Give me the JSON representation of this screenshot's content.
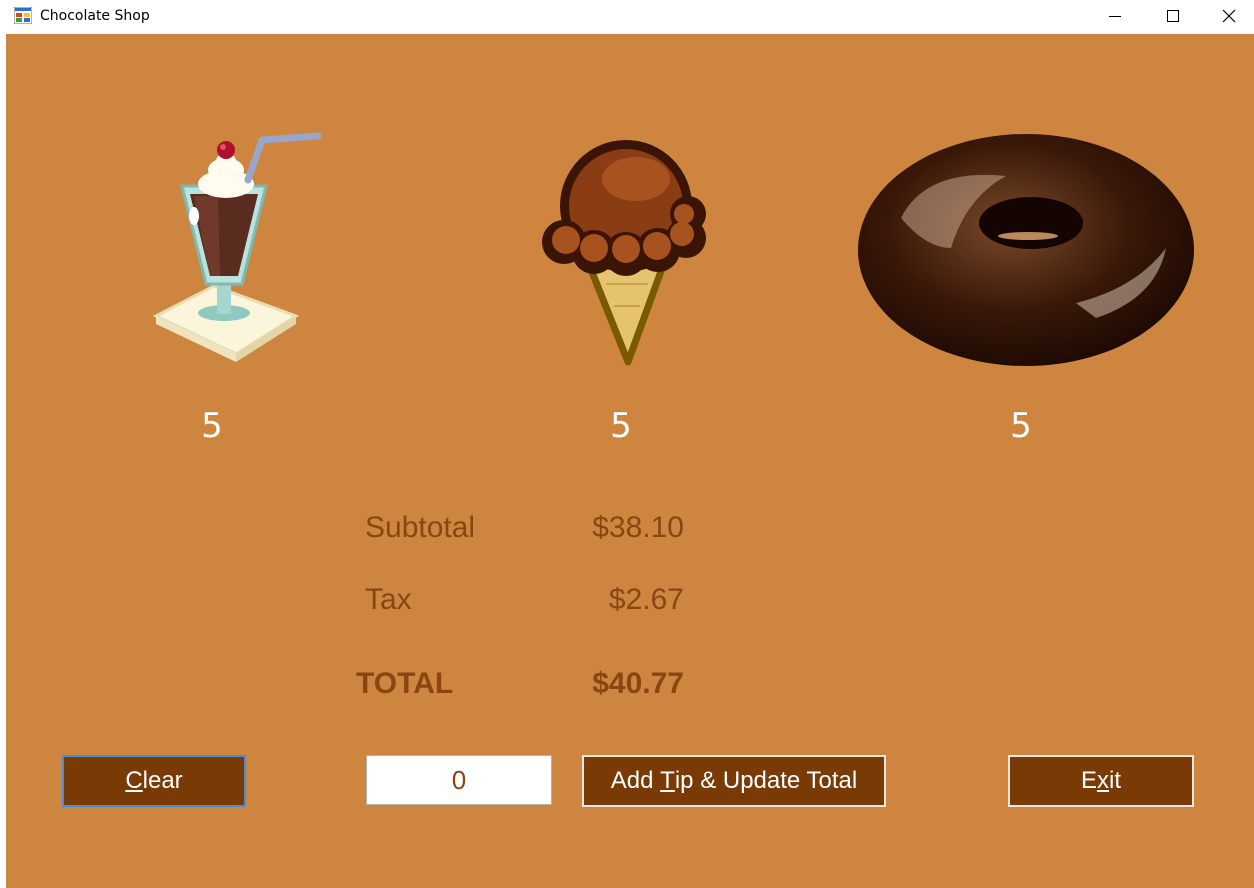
{
  "window": {
    "title": "Chocolate Shop"
  },
  "colors": {
    "background": "#cd853f",
    "button": "#7a3a06",
    "summary_text": "#8b4513",
    "quantity_text": "#ffffff"
  },
  "products": [
    {
      "icon": "chocolate-milkshake-icon",
      "quantity": "5"
    },
    {
      "icon": "chocolate-ice-cream-cone-icon",
      "quantity": "5"
    },
    {
      "icon": "chocolate-donut-icon",
      "quantity": "5"
    }
  ],
  "summary": {
    "subtotal_label": "Subtotal",
    "subtotal_value": "$38.10",
    "tax_label": "Tax",
    "tax_value": "$2.67",
    "total_label": "TOTAL",
    "total_value": "$40.77"
  },
  "controls": {
    "clear_pre": "",
    "clear_mnemonic": "C",
    "clear_post": "lear",
    "tip_value": "0",
    "add_tip_pre": "Add ",
    "add_tip_mnemonic": "T",
    "add_tip_post": "ip & Update Total",
    "exit_pre": "E",
    "exit_mnemonic": "x",
    "exit_post": "it"
  }
}
